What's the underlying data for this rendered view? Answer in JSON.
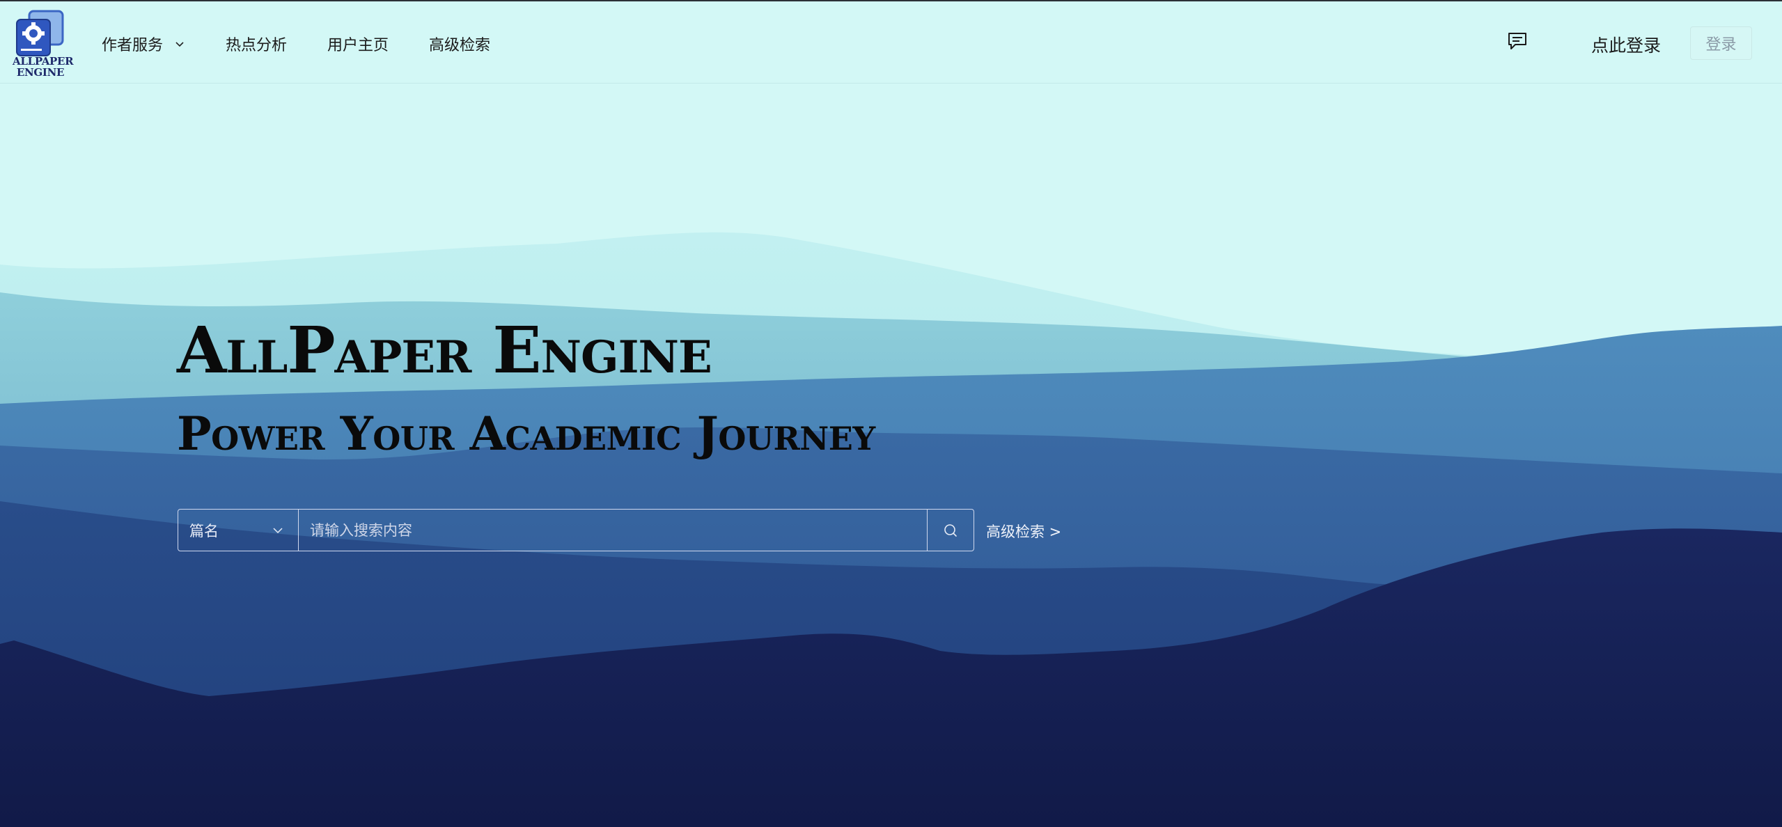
{
  "logo": {
    "line1": "ALLPAPER",
    "line2": "ENGINE"
  },
  "nav": {
    "items": [
      {
        "label": "作者服务",
        "has_dropdown": true
      },
      {
        "label": "热点分析"
      },
      {
        "label": "用户主页"
      },
      {
        "label": "高级检索"
      }
    ]
  },
  "header_right": {
    "message_icon": "message-icon",
    "login_link": "点此登录",
    "login_button": "登录"
  },
  "hero": {
    "title": "AllPaper Engine",
    "subtitle": "Power Your Academic Journey"
  },
  "search": {
    "select_value": "篇名",
    "placeholder": "请输入搜索内容",
    "search_icon": "search-icon",
    "advanced_link": "高级检索 >"
  },
  "colors": {
    "sky": "#d3f8f6",
    "deep_navy": "#141d4f",
    "mid_blue": "#3a6ea3"
  }
}
